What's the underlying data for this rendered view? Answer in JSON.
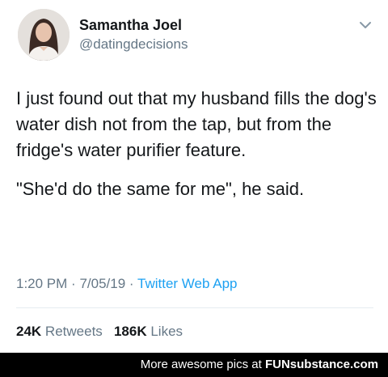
{
  "tweet": {
    "author_name": "Samantha Joel",
    "author_handle": "@datingdecisions",
    "text_paragraph_1": "I just found out that my husband fills the dog's water dish not from the tap, but from the fridge's water purifier feature.",
    "text_paragraph_2": "\"She'd do the same for me\", he said.",
    "time": "1:20 PM",
    "date": "7/05/19",
    "source": "Twitter Web App",
    "separator": "·",
    "retweets_count": "24K",
    "retweets_label": "Retweets",
    "likes_count": "186K",
    "likes_label": "Likes"
  },
  "footer": {
    "prefix": "More awesome pics at ",
    "brand": "FUNsubstance.com"
  },
  "icons": {
    "menu": "chevron-down-icon",
    "avatar": "avatar-photo"
  },
  "colors": {
    "link": "#1da1f2",
    "muted": "#657786",
    "text": "#14171a",
    "footer_bg": "#000000"
  }
}
